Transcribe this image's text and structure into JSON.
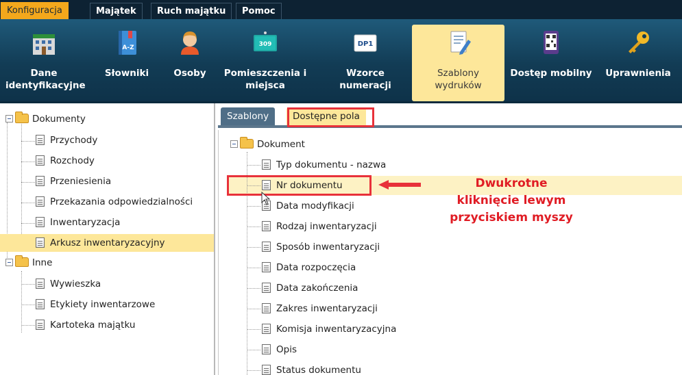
{
  "menu": {
    "items": [
      "Konfiguracja",
      "Majątek",
      "Ruch majątku",
      "Pomoc"
    ]
  },
  "toolbar": {
    "items": [
      {
        "line1": "Dane",
        "line2": "identyfikacyjne",
        "icon": "building-icon"
      },
      {
        "line1": "Słowniki",
        "line2": "",
        "icon": "dictionary-book-icon",
        "icon_text": "A-Z"
      },
      {
        "line1": "Osoby",
        "line2": "",
        "icon": "person-icon"
      },
      {
        "line1": "Pomieszczenia i",
        "line2": "miejsca",
        "icon": "room-door-icon",
        "icon_text": "309"
      },
      {
        "line1": "Wzorce",
        "line2": "numeracji",
        "icon": "numbering-card-icon",
        "icon_text": "DP1"
      },
      {
        "line1": "Szablony",
        "line2": "wydruków",
        "icon": "print-template-icon"
      },
      {
        "line1": "Dostęp mobilny",
        "line2": "",
        "icon": "qr-phone-icon"
      },
      {
        "line1": "Uprawnienia",
        "line2": "",
        "icon": "key-icon"
      }
    ]
  },
  "left_tree": {
    "groups": [
      {
        "label": "Dokumenty",
        "children": [
          "Przychody",
          "Rozchody",
          "Przeniesienia",
          "Przekazania odpowiedzialności",
          "Inwentaryzacja",
          "Arkusz inwentaryzacyjny"
        ]
      },
      {
        "label": "Inne",
        "children": [
          "Wywieszka",
          "Etykiety inwentarzowe",
          "Kartoteka majątku"
        ]
      }
    ],
    "selected": "Arkusz inwentaryzacyjny"
  },
  "tabs": [
    "Szablony",
    "Dostępne pola"
  ],
  "fields_tree": {
    "root": "Dokument",
    "items": [
      "Typ dokumentu - nazwa",
      "Nr dokumentu",
      "Data modyfikacji",
      "Rodzaj inwentaryzacji",
      "Sposób inwentaryzacji",
      "Data rozpoczęcia",
      "Data zakończenia",
      "Zakres inwentaryzacji",
      "Komisja inwentaryzacyjna",
      "Opis",
      "Status dokumentu"
    ]
  },
  "annotation": {
    "line1": "Dwukrotne",
    "line2": "kliknięcie lewym",
    "line3": "przyciskiem myszy",
    "color": "#e01c24"
  },
  "colors": {
    "accent": "#f4a81c",
    "highlight": "#fde79a",
    "toolbar": "#123c55",
    "callout": "#e8313a"
  }
}
